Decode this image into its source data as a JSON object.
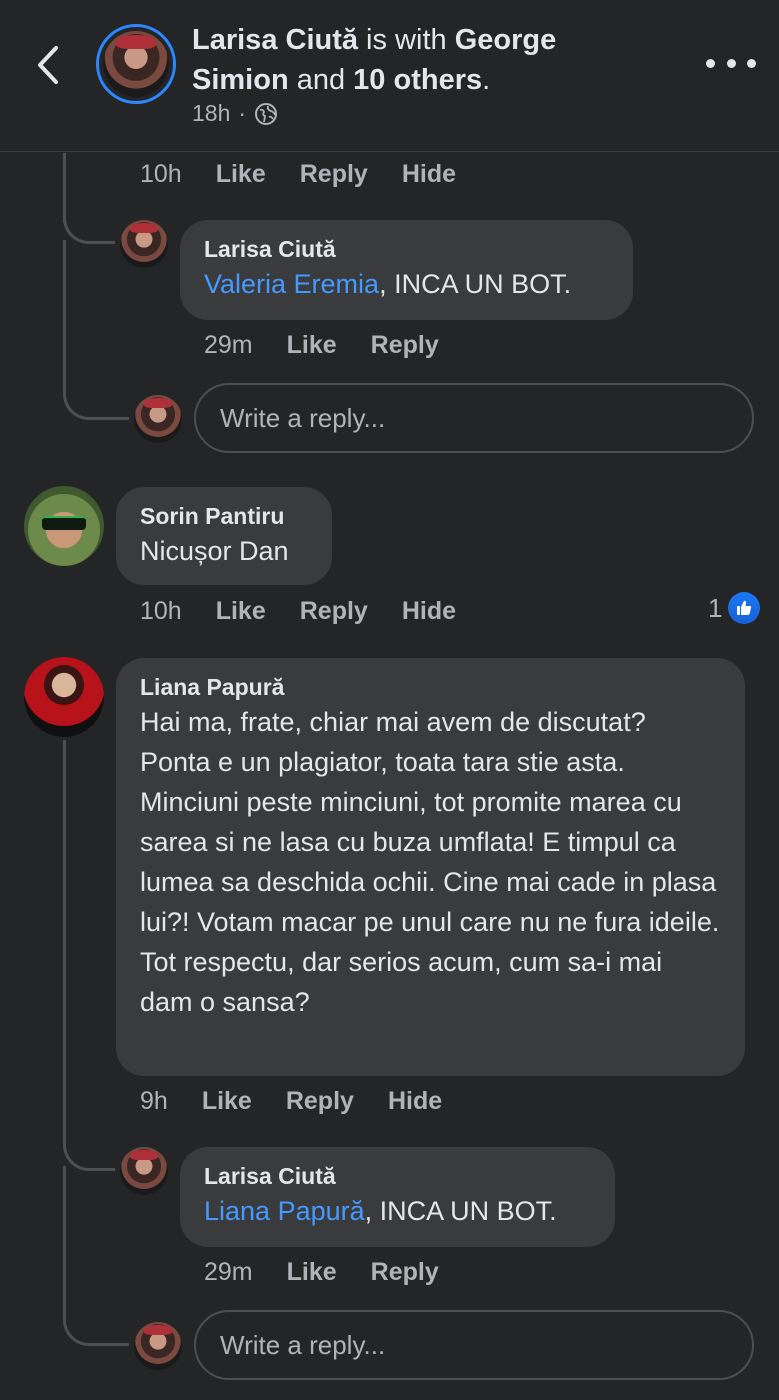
{
  "header": {
    "author": "Larisa Ciută",
    "is_with": " is with ",
    "tagged": "George Simion",
    "and": " and ",
    "others": "10 others",
    "period": ".",
    "time": "18h",
    "separator": "·"
  },
  "top_actions": {
    "time": "10h",
    "like": "Like",
    "reply": "Reply",
    "hide": "Hide"
  },
  "reply1": {
    "name": "Larisa Ciută",
    "mention": "Valeria Eremia",
    "text": ", INCA UN BOT.",
    "time": "29m",
    "like": "Like",
    "reply": "Reply"
  },
  "reply_input_1": {
    "placeholder": "Write a reply..."
  },
  "comment_sorin": {
    "name": "Sorin Pantiru",
    "text": "Nicușor Dan",
    "time": "10h",
    "like": "Like",
    "reply": "Reply",
    "hide": "Hide",
    "like_count": "1"
  },
  "comment_liana": {
    "name": "Liana Papură",
    "text": "Hai ma, frate, chiar mai avem de discutat? Ponta e un plagiator, toata tara stie asta. Minciuni peste minciuni, tot promite marea cu sarea si ne lasa cu buza umflata! E timpul ca lumea sa deschida ochii. Cine mai cade in plasa lui?! Votam macar pe unul care nu ne fura ideile. Tot respectu, dar serios acum, cum sa-i mai dam o sansa?",
    "time": "9h",
    "like": "Like",
    "reply": "Reply",
    "hide": "Hide"
  },
  "reply2": {
    "name": "Larisa Ciută",
    "mention": "Liana Papură",
    "text": ", INCA UN BOT.",
    "time": "29m",
    "like": "Like",
    "reply": "Reply"
  },
  "reply_input_2": {
    "placeholder": "Write a reply..."
  },
  "colors": {
    "background": "#242526",
    "bubble": "#3a3b3c",
    "mention": "#4599ff",
    "accent": "#2d88ff"
  }
}
